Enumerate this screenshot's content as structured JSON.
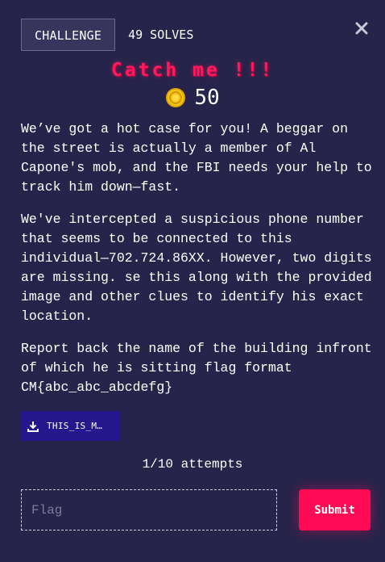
{
  "header": {
    "tab_challenge": "CHALLENGE",
    "tab_solves": "49 SOLVES"
  },
  "challenge": {
    "title": "Catch me !!!",
    "points": "50",
    "description": [
      "We’ve got a hot case for you! A beggar on the street is actually a member of Al Capone's mob, and the FBI needs your help to track him down—fast.",
      "We've intercepted a suspicious phone number that seems to be connected to this individual—702.724.86XX. However, two digits are missing. se this along with the provided image and other clues to identify his exact location.",
      "Report back the name of the building infront of which he is sitting flag format CM{abc_abc_abcdefg}"
    ]
  },
  "file": {
    "label": "THIS_IS_M…"
  },
  "attempts": "1/10 attempts",
  "form": {
    "flag_placeholder": "Flag",
    "flag_value": "",
    "submit_label": "Submit"
  },
  "icons": {
    "close": "close-icon",
    "coin": "coin-icon",
    "download": "download-icon"
  },
  "colors": {
    "background": "#26244a",
    "accent": "#ff0a55",
    "title": "#ff1a5e",
    "download_button": "#24188c",
    "coin": "#f5c518"
  }
}
